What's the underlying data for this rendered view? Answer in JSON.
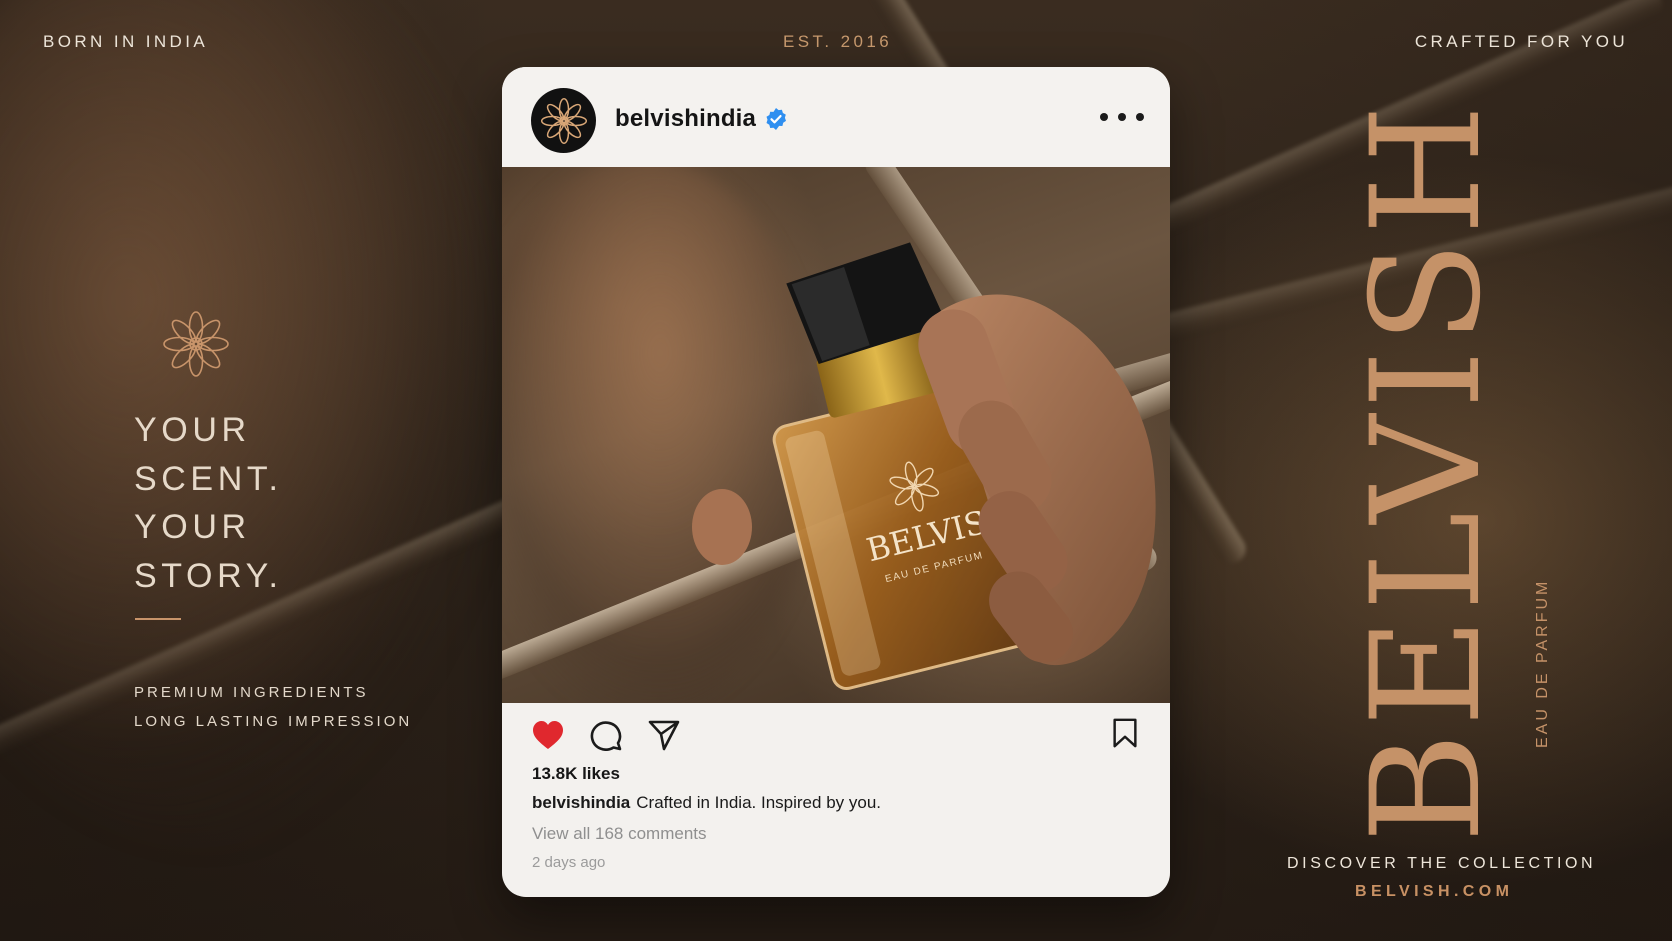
{
  "top": {
    "left": "BORN IN INDIA",
    "center": "EST. 2016",
    "right": "CRAFTED FOR YOU"
  },
  "left_panel": {
    "tagline": [
      "YOUR",
      "SCENT.",
      "YOUR",
      "STORY."
    ],
    "features": [
      "PREMIUM INGREDIENTS",
      "LONG LASTING IMPRESSION"
    ],
    "icon": "lotus-icon"
  },
  "post": {
    "username": "belvishindia",
    "verified_icon": "verified-badge-icon",
    "avatar_icon": "lotus-icon",
    "more_icon": "more-dots-icon",
    "image": {
      "bottle_label": "BELVIS",
      "bottle_sublabel": "EAU DE PARFUM"
    },
    "actions": {
      "like_icon": "heart-icon",
      "comment_icon": "comment-icon",
      "share_icon": "send-icon",
      "save_icon": "bookmark-icon",
      "liked": true
    },
    "likes": "13.8K likes",
    "caption_user": "belvishindia",
    "caption_text": "Crafted in India. Inspired by you.",
    "comments_link": "View all 168 comments",
    "time": "2 days ago"
  },
  "right_panel": {
    "brand": "BELVISH",
    "subtitle": "EAU DE PARFUM",
    "cta": "DISCOVER THE COLLECTION",
    "site": "BELVISH.COM"
  },
  "colors": {
    "gold": "#c59268",
    "like_red": "#e0282e",
    "verified_blue": "#2f8ff0",
    "card_bg": "#f3f1ee"
  }
}
